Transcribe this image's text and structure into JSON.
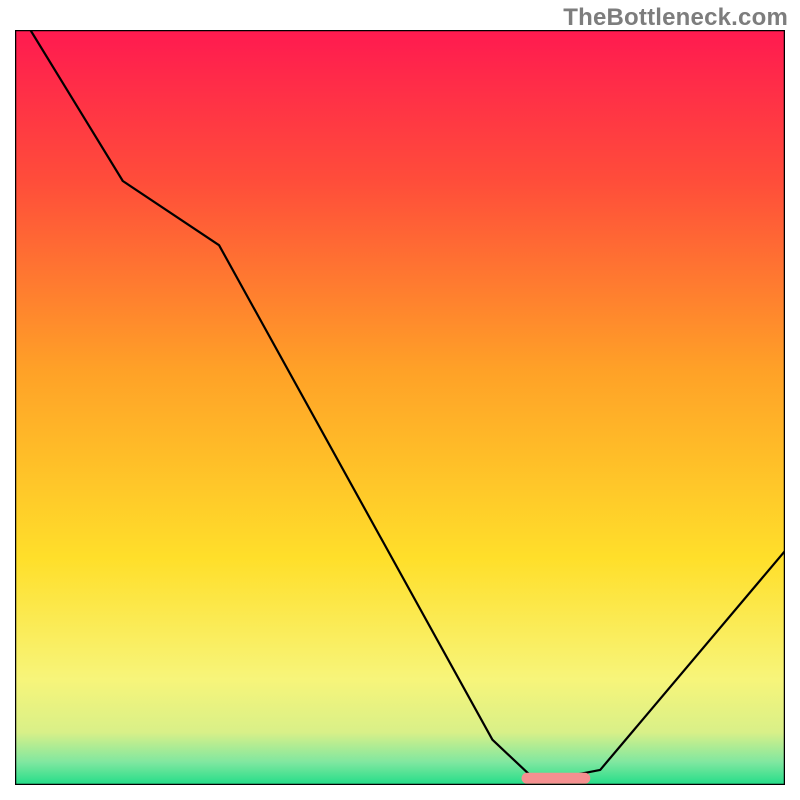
{
  "watermark": "TheBottleneck.com",
  "chart_data": {
    "type": "line",
    "title": "",
    "xlabel": "",
    "ylabel": "",
    "xlim": [
      0,
      100
    ],
    "ylim": [
      0,
      100
    ],
    "grid": false,
    "legend": false,
    "gradient_stops": [
      {
        "offset": 0.0,
        "color": "#ff1a50"
      },
      {
        "offset": 0.2,
        "color": "#ff4d3a"
      },
      {
        "offset": 0.45,
        "color": "#ffa127"
      },
      {
        "offset": 0.7,
        "color": "#ffdf2a"
      },
      {
        "offset": 0.86,
        "color": "#f7f57a"
      },
      {
        "offset": 0.93,
        "color": "#d9f088"
      },
      {
        "offset": 0.97,
        "color": "#7fe7a0"
      },
      {
        "offset": 1.0,
        "color": "#22dd88"
      }
    ],
    "series": [
      {
        "name": "bottleneck-curve",
        "color": "#000000",
        "x": [
          2.0,
          14.0,
          26.5,
          62.0,
          67.0,
          72.0,
          76.0,
          100.0
        ],
        "values": [
          100.0,
          80.0,
          71.5,
          6.0,
          1.2,
          1.2,
          2.0,
          31.0
        ]
      }
    ],
    "marker": {
      "name": "optimal-range",
      "color": "#f59090",
      "x_start": 66.5,
      "x_end": 74.0,
      "y": 0.9,
      "thickness": 1.6
    },
    "axes": {
      "frame_color": "#000000",
      "frame_width": 2.5
    }
  }
}
